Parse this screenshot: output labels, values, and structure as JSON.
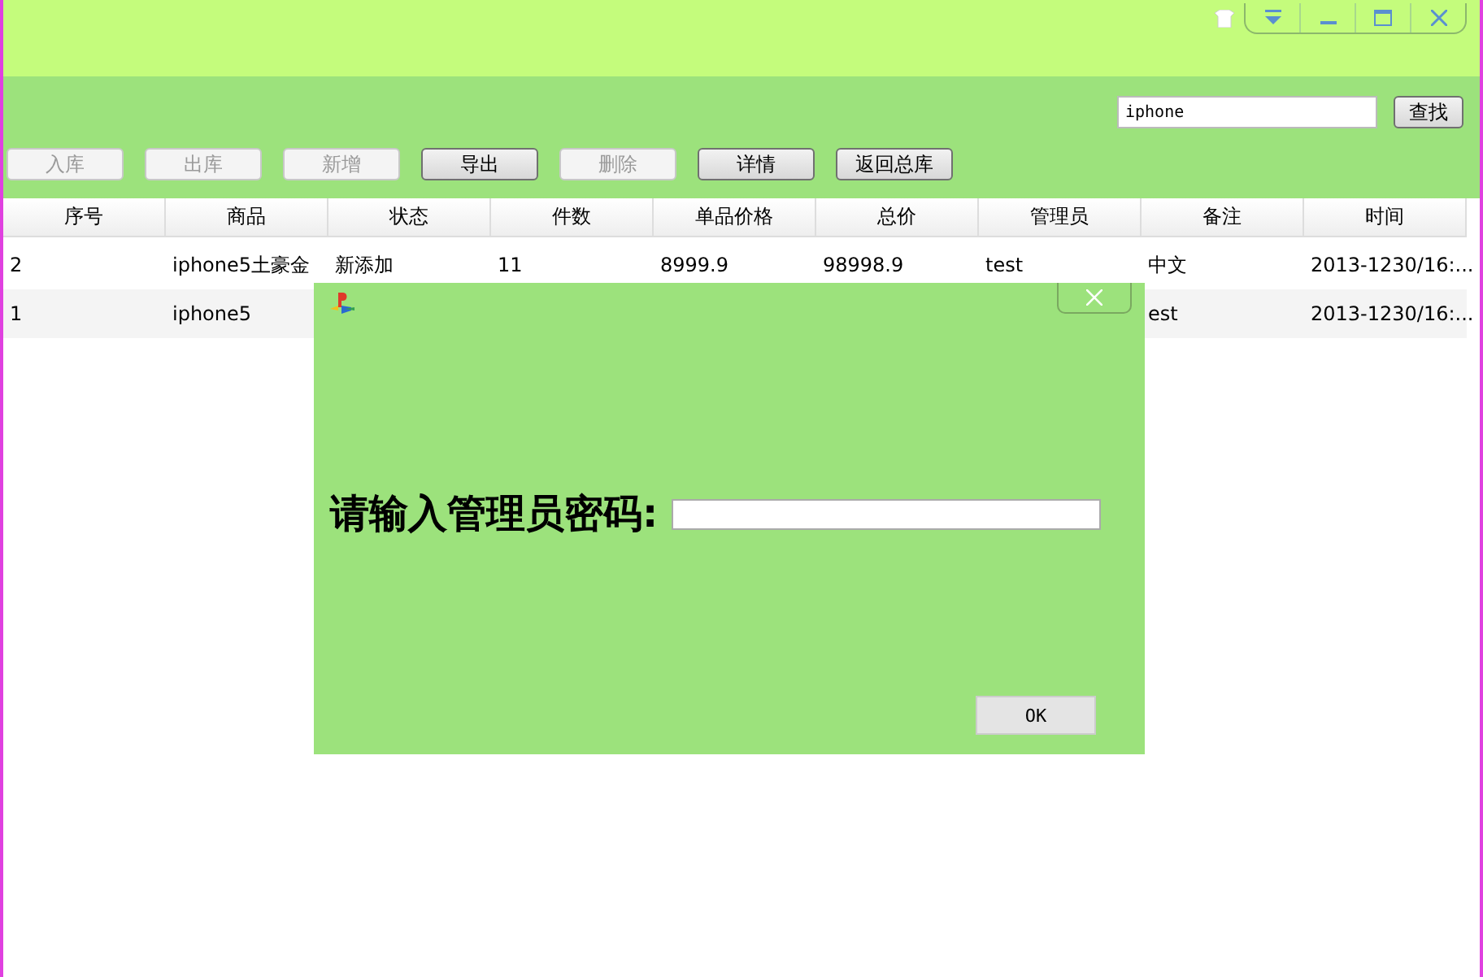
{
  "search": {
    "value": "iphone",
    "button": "查找"
  },
  "toolbar": [
    {
      "label": "入库",
      "disabled": true
    },
    {
      "label": "出库",
      "disabled": true
    },
    {
      "label": "新增",
      "disabled": true
    },
    {
      "label": "导出",
      "disabled": false
    },
    {
      "label": "删除",
      "disabled": true
    },
    {
      "label": "详情",
      "disabled": false
    },
    {
      "label": "返回总库",
      "disabled": false
    }
  ],
  "table": {
    "columns": [
      "序号",
      "商品",
      "状态",
      "件数",
      "单品价格",
      "总价",
      "管理员",
      "备注",
      "时间"
    ],
    "rows": [
      [
        "2",
        "iphone5土豪金",
        "新添加",
        "11",
        "8999.9",
        "98998.9",
        "test",
        "中文",
        "2013-1230/16:..."
      ],
      [
        "1",
        "iphone5",
        "",
        "",
        "",
        "",
        "",
        "est",
        "2013-1230/16:..."
      ]
    ]
  },
  "dialog": {
    "prompt": "请输入管理员密码:",
    "button": "OK"
  }
}
